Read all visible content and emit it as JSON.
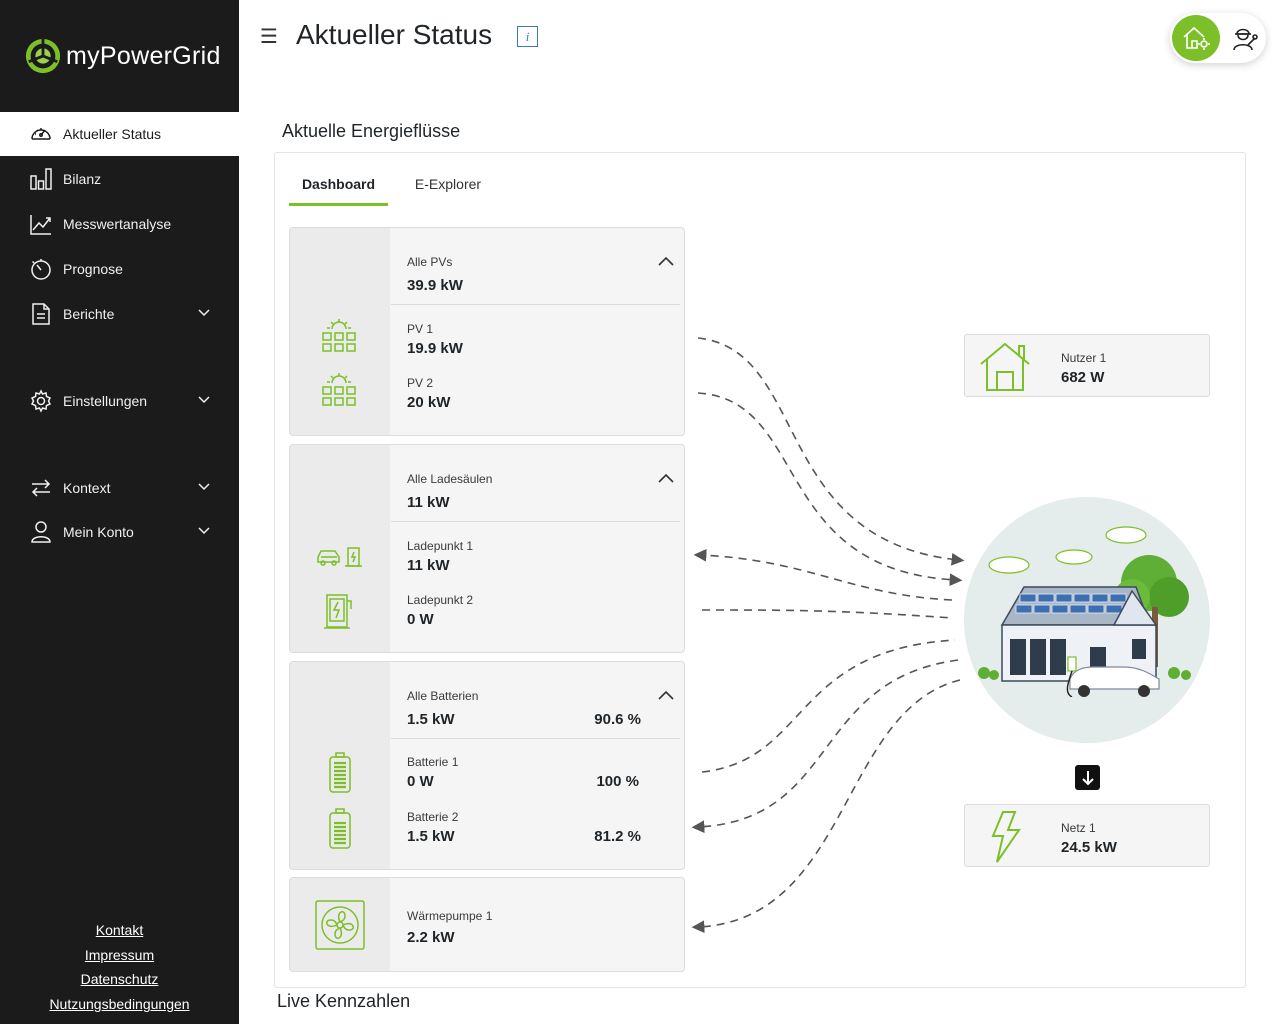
{
  "app": {
    "name": "myPowerGrid"
  },
  "sidebar": {
    "items": [
      {
        "label": "Aktueller Status",
        "icon": "gauge-icon",
        "active": true
      },
      {
        "label": "Bilanz",
        "icon": "bar-chart-icon"
      },
      {
        "label": "Messwertanalyse",
        "icon": "line-chart-icon"
      },
      {
        "label": "Prognose",
        "icon": "timer-icon"
      },
      {
        "label": "Berichte",
        "icon": "document-icon",
        "expandable": true
      },
      {
        "label": "Einstellungen",
        "icon": "gear-icon",
        "expandable": true
      },
      {
        "label": "Kontext",
        "icon": "swap-arrows-icon",
        "expandable": true
      },
      {
        "label": "Mein Konto",
        "icon": "user-icon",
        "expandable": true
      }
    ],
    "footer_links": [
      "Kontakt",
      "Impressum",
      "Datenschutz",
      "Nutzungsbedingungen"
    ]
  },
  "header": {
    "title": "Aktueller Status",
    "info_icon": "info-icon",
    "info_glyph": "i"
  },
  "section": {
    "title": "Aktuelle Energieflüsse"
  },
  "tabs": [
    {
      "label": "Dashboard",
      "active": true
    },
    {
      "label": "E-Explorer",
      "active": false
    }
  ],
  "cards": {
    "pv": {
      "summary_label": "Alle PVs",
      "summary_value": "39.9 kW",
      "items": [
        {
          "label": "PV 1",
          "value": "19.9 kW"
        },
        {
          "label": "PV 2",
          "value": "20 kW"
        }
      ]
    },
    "charging": {
      "summary_label": "Alle Ladesäulen",
      "summary_value": "11 kW",
      "items": [
        {
          "label": "Ladepunkt 1",
          "value": "11 kW"
        },
        {
          "label": "Ladepunkt 2",
          "value": "0 W"
        }
      ]
    },
    "battery": {
      "summary_label": "Alle Batterien",
      "summary_value": "1.5 kW",
      "summary_soc": "90.6 %",
      "items": [
        {
          "label": "Batterie 1",
          "value": "0 W",
          "soc": "100 %"
        },
        {
          "label": "Batterie 2",
          "value": "1.5 kW",
          "soc": "81.2 %"
        }
      ]
    },
    "heatpump": {
      "label": "Wärmepumpe 1",
      "value": "2.2 kW"
    }
  },
  "nodes": {
    "consumer": {
      "label": "Nutzer 1",
      "value": "682 W"
    },
    "grid": {
      "label": "Netz 1",
      "value": "24.5 kW"
    }
  },
  "live": {
    "title": "Live Kennzahlen"
  },
  "colors": {
    "accent": "#7cbf28",
    "sidebar_bg": "#1b1b1b",
    "info": "#3a78c8"
  }
}
